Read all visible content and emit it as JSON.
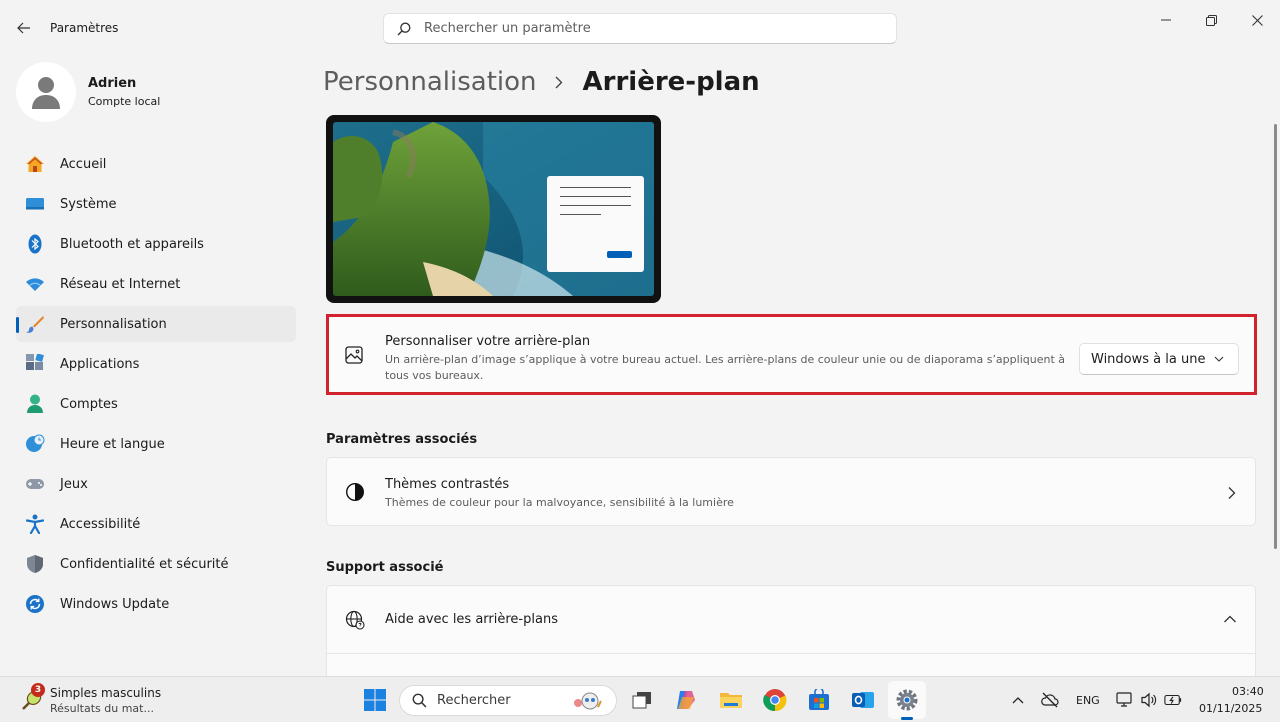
{
  "window": {
    "title": "Paramètres",
    "search_placeholder": "Rechercher un paramètre"
  },
  "profile": {
    "name": "Adrien",
    "account_type": "Compte local"
  },
  "sidebar": {
    "items": [
      {
        "label": "Accueil",
        "icon": "home-icon"
      },
      {
        "label": "Système",
        "icon": "system-icon"
      },
      {
        "label": "Bluetooth et appareils",
        "icon": "bluetooth-icon"
      },
      {
        "label": "Réseau et Internet",
        "icon": "wifi-icon"
      },
      {
        "label": "Personnalisation",
        "icon": "brush-icon",
        "active": true
      },
      {
        "label": "Applications",
        "icon": "apps-icon"
      },
      {
        "label": "Comptes",
        "icon": "user-icon"
      },
      {
        "label": "Heure et langue",
        "icon": "globe-clock-icon"
      },
      {
        "label": "Jeux",
        "icon": "gamepad-icon"
      },
      {
        "label": "Accessibilité",
        "icon": "accessibility-icon"
      },
      {
        "label": "Confidentialité et sécurité",
        "icon": "shield-icon"
      },
      {
        "label": "Windows Update",
        "icon": "update-icon"
      }
    ]
  },
  "breadcrumb": {
    "parent": "Personnalisation",
    "current": "Arrière-plan"
  },
  "background_card": {
    "title": "Personnaliser votre arrière-plan",
    "description": "Un arrière-plan d’image s’applique à votre bureau actuel. Les arrière-plans de couleur unie ou de diaporama s’appliquent à tous vos bureaux.",
    "dropdown_value": "Windows à la une"
  },
  "related_settings": {
    "heading": "Paramètres associés",
    "items": [
      {
        "title": "Thèmes contrastés",
        "description": "Thèmes de couleur pour la malvoyance, sensibilité à la lumière"
      }
    ]
  },
  "related_support": {
    "heading": "Support associé",
    "items": [
      {
        "title": "Aide avec les arrière-plans"
      }
    ]
  },
  "taskbar": {
    "news_badge": "3",
    "news_title": "Simples masculins",
    "news_subtitle": "Résultats du mat...",
    "search_label": "Rechercher",
    "language": "ENG",
    "time": "03:40",
    "date": "01/11/2025"
  },
  "colors": {
    "accent": "#005fb8",
    "highlight_border": "#d1222e"
  }
}
